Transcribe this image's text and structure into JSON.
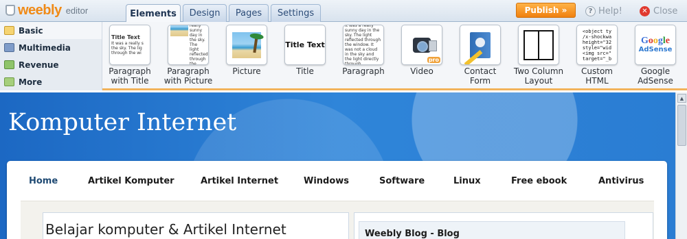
{
  "logo": {
    "brand": "weebly",
    "sub": "editor"
  },
  "tabs": [
    {
      "label": "Elements",
      "active": true
    },
    {
      "label": "Design"
    },
    {
      "label": "Pages"
    },
    {
      "label": "Settings"
    }
  ],
  "actions": {
    "publish": "Publish »",
    "help": "Help!",
    "close": "Close"
  },
  "sidebar": {
    "items": [
      {
        "label": "Basic",
        "icon": "folder-icon"
      },
      {
        "label": "Multimedia",
        "icon": "film-icon"
      },
      {
        "label": "Revenue",
        "icon": "money-icon"
      },
      {
        "label": "More",
        "icon": "puzzle-icon"
      }
    ]
  },
  "elements": [
    {
      "label": "Paragraph\nwith Title",
      "preview_title": "Title Text",
      "preview_text": "It was a really s the sky. The lig through the wi"
    },
    {
      "label": "Paragraph\nwith Picture",
      "preview_text": "It was a really sunny day in the sky. The light reflected through the window"
    },
    {
      "label": "Picture"
    },
    {
      "label": "Title",
      "preview_title": "Title Text"
    },
    {
      "label": "Paragraph",
      "preview_text": "It was a really sunny day in the sky. The light reflected through the window. It was not a cloud in the sky and the light directly through"
    },
    {
      "label": "Video",
      "badge": "pro"
    },
    {
      "label": "Contact\nForm"
    },
    {
      "label": "Two Column\nLayout"
    },
    {
      "label": "Custom\nHTML",
      "preview_code": "<object ty\n/x-shockwa\nheight=\"32\nstyle=\"wid\n<img src=\"\ntarget=\"_b"
    },
    {
      "label": "Google\nAdSense",
      "preview_word": "Google",
      "preview_sub": "AdSense"
    }
  ],
  "site": {
    "title": "Komputer Internet",
    "nav": [
      "Home",
      "Artikel Komputer",
      "Artikel Internet",
      "Windows",
      "Software",
      "Linux",
      "Free ebook",
      "Antivirus"
    ],
    "post_title": "Belajar komputer & Artikel Internet",
    "blog_title": "Weebly Blog - Blog"
  },
  "scrollbar": {
    "up_arrow": "▲"
  }
}
